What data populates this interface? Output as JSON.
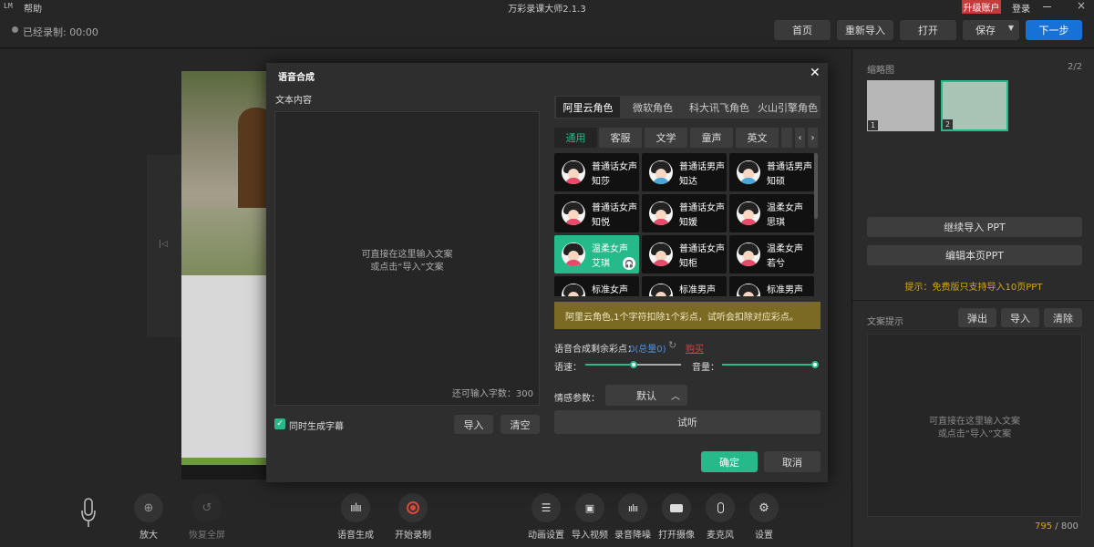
{
  "titlebar": {
    "logo": "LM",
    "menu_help": "帮助",
    "title": "万彩录课大师2.1.3",
    "upgrade": "升级账户",
    "login": "登录"
  },
  "topbar": {
    "record_status": "已经录制: 00:00",
    "home": "首页",
    "reimport": "重新导入",
    "open": "打开",
    "save": "保存",
    "next": "下一步"
  },
  "bottom_tools": {
    "zoom_in": "放大",
    "restore": "恢复全屏",
    "voice_gen": "语音生成",
    "start_record": "开始录制",
    "anim": "动画设置",
    "import_video": "导入视频",
    "denoise": "录音降噪",
    "camera": "打开摄像",
    "mic": "麦克风",
    "settings": "设置"
  },
  "right": {
    "thumb_title": "缩略图",
    "thumb_count": "2/2",
    "thumb1": "1",
    "thumb2": "2",
    "continue_import": "继续导入 PPT",
    "edit_page": "编辑本页PPT",
    "hint": "提示：免费版只支持导入10页PPT",
    "script_title": "文案提示",
    "popout": "弹出",
    "import": "导入",
    "clear": "清除",
    "placeholder1": "可直接在这里输入文案",
    "placeholder2": "或点击“导入”文案",
    "count_used": "795",
    "count_sep": " / ",
    "count_total": "800"
  },
  "modal": {
    "title": "语音合成",
    "text_label": "文本内容",
    "placeholder1": "可直接在这里输入文案",
    "placeholder2": "或点击“导入”文案",
    "remaining": "还可输入字数：300",
    "subtitle_check": "同时生成字幕",
    "import": "导入",
    "clear": "清空",
    "tabs": [
      "阿里云角色",
      "微软角色",
      "科大讯飞角色",
      "火山引擎角色"
    ],
    "cats": [
      "通用",
      "客服",
      "文学",
      "童声",
      "英文"
    ],
    "voices": [
      {
        "l1": "普通话女声",
        "l2": "知莎",
        "gender": "f"
      },
      {
        "l1": "普通话男声",
        "l2": "知达",
        "gender": "m"
      },
      {
        "l1": "普通话男声",
        "l2": "知硕",
        "gender": "m"
      },
      {
        "l1": "普通话女声",
        "l2": "知悦",
        "gender": "f"
      },
      {
        "l1": "普通话女声",
        "l2": "知媛",
        "gender": "f"
      },
      {
        "l1": "温柔女声",
        "l2": "思琪",
        "gender": "f"
      },
      {
        "l1": "温柔女声",
        "l2": "艾琪",
        "gender": "f",
        "selected": true
      },
      {
        "l1": "普通话女声",
        "l2": "知柜",
        "gender": "f"
      },
      {
        "l1": "温柔女声",
        "l2": "若兮",
        "gender": "f"
      },
      {
        "l1": "标准女声",
        "l2": "",
        "gender": "f"
      },
      {
        "l1": "标准男声",
        "l2": "",
        "gender": "m"
      },
      {
        "l1": "标准男声",
        "l2": "",
        "gender": "m"
      }
    ],
    "notice": "阿里云角色,1个字符扣除1个彩点，试听会扣除对应彩点。",
    "points_label": "语音合成剩余彩点：",
    "points_value": "0(总量0)",
    "buy": "购买",
    "speed_label": "语速：",
    "speed_value": 0.5,
    "volume_label": "音量：",
    "volume_value": 1.0,
    "emotion_label": "情感参数：",
    "emotion_value": "默认",
    "preview": "试听",
    "ok": "确定",
    "cancel": "取消"
  },
  "colors": {
    "accent": "#26b98a",
    "primary": "#1772d8",
    "upgrade": "#c63a3a",
    "hint": "#d4a617"
  }
}
